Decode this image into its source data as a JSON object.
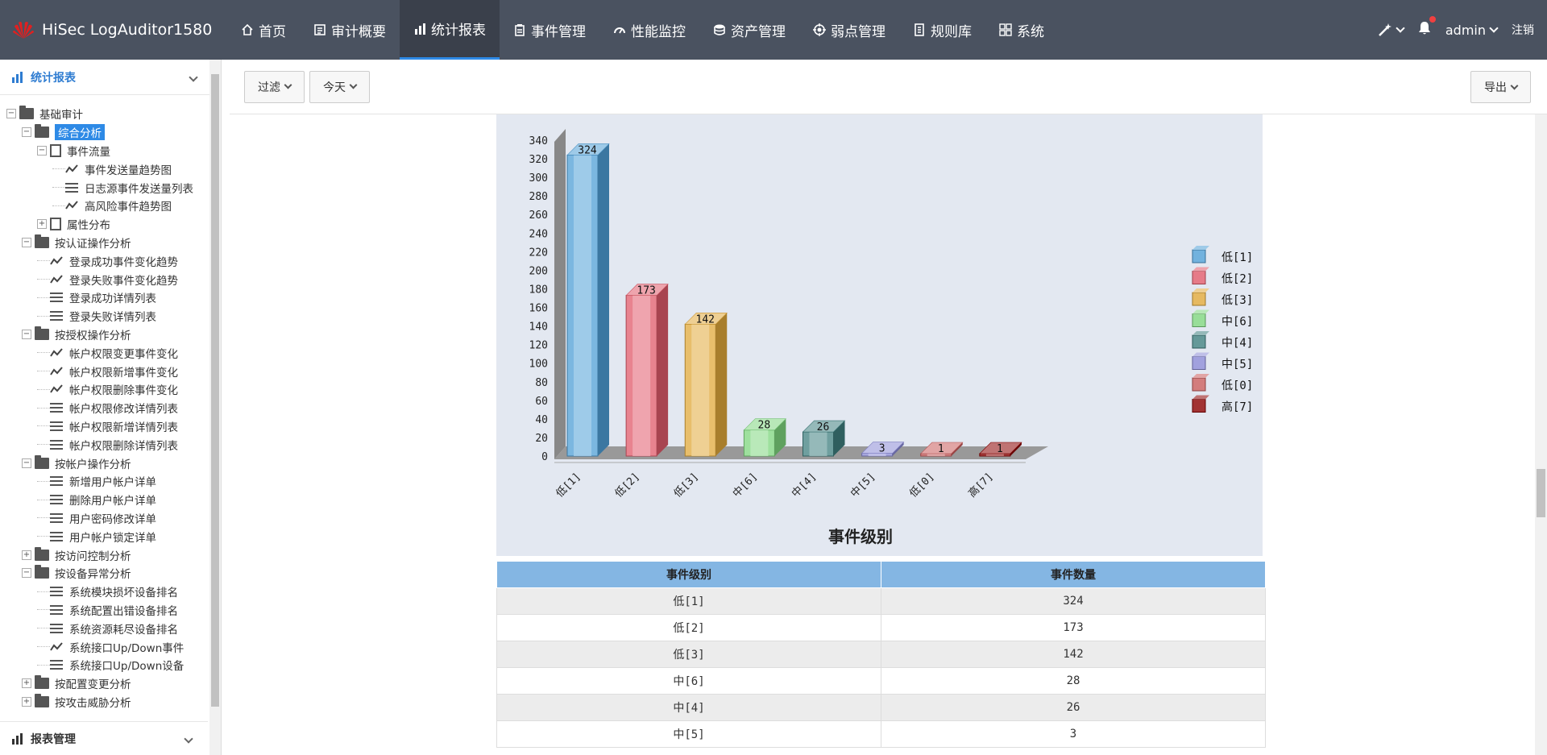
{
  "app": {
    "title": "HiSec LogAuditor1580"
  },
  "nav": [
    {
      "label": "首页",
      "icon": "home-icon"
    },
    {
      "label": "审计概要",
      "icon": "report-icon"
    },
    {
      "label": "统计报表",
      "icon": "bar-chart-icon",
      "active": true
    },
    {
      "label": "事件管理",
      "icon": "clipboard-icon"
    },
    {
      "label": "性能监控",
      "icon": "gauge-icon"
    },
    {
      "label": "资产管理",
      "icon": "database-icon"
    },
    {
      "label": "弱点管理",
      "icon": "target-icon"
    },
    {
      "label": "规则库",
      "icon": "book-icon"
    },
    {
      "label": "系统",
      "icon": "grid-icon"
    }
  ],
  "user": {
    "name": "admin",
    "logout": "注销"
  },
  "sidebar": {
    "header": "统计报表",
    "footer": "报表管理",
    "tree": [
      {
        "label": "基础审计",
        "level": 0,
        "kind": "folder-open",
        "toggle": "−"
      },
      {
        "label": "综合分析",
        "level": 1,
        "kind": "folder",
        "toggle": "−",
        "selected": true
      },
      {
        "label": "事件流量",
        "level": 2,
        "kind": "doc",
        "toggle": "−"
      },
      {
        "label": "事件发送量趋势图",
        "level": 3,
        "kind": "trend"
      },
      {
        "label": "日志源事件发送量列表",
        "level": 3,
        "kind": "list"
      },
      {
        "label": "高风险事件趋势图",
        "level": 3,
        "kind": "trend"
      },
      {
        "label": "属性分布",
        "level": 2,
        "kind": "doc",
        "toggle": "+"
      },
      {
        "label": "按认证操作分析",
        "level": 1,
        "kind": "folder",
        "toggle": "−"
      },
      {
        "label": "登录成功事件变化趋势",
        "level": 2,
        "kind": "trend"
      },
      {
        "label": "登录失败事件变化趋势",
        "level": 2,
        "kind": "trend"
      },
      {
        "label": "登录成功详情列表",
        "level": 2,
        "kind": "list"
      },
      {
        "label": "登录失败详情列表",
        "level": 2,
        "kind": "list"
      },
      {
        "label": "按授权操作分析",
        "level": 1,
        "kind": "folder",
        "toggle": "−"
      },
      {
        "label": "帐户权限变更事件变化",
        "level": 2,
        "kind": "trend"
      },
      {
        "label": "帐户权限新增事件变化",
        "level": 2,
        "kind": "trend"
      },
      {
        "label": "帐户权限删除事件变化",
        "level": 2,
        "kind": "trend"
      },
      {
        "label": "帐户权限修改详情列表",
        "level": 2,
        "kind": "list"
      },
      {
        "label": "帐户权限新增详情列表",
        "level": 2,
        "kind": "list"
      },
      {
        "label": "帐户权限删除详情列表",
        "level": 2,
        "kind": "list"
      },
      {
        "label": "按帐户操作分析",
        "level": 1,
        "kind": "folder",
        "toggle": "−"
      },
      {
        "label": "新增用户帐户详单",
        "level": 2,
        "kind": "list"
      },
      {
        "label": "删除用户帐户详单",
        "level": 2,
        "kind": "list"
      },
      {
        "label": "用户密码修改详单",
        "level": 2,
        "kind": "list"
      },
      {
        "label": "用户帐户锁定详单",
        "level": 2,
        "kind": "list"
      },
      {
        "label": "按访问控制分析",
        "level": 1,
        "kind": "folder",
        "toggle": "+"
      },
      {
        "label": "按设备异常分析",
        "level": 1,
        "kind": "folder",
        "toggle": "−"
      },
      {
        "label": "系统模块损坏设备排名",
        "level": 2,
        "kind": "list"
      },
      {
        "label": "系统配置出错设备排名",
        "level": 2,
        "kind": "list"
      },
      {
        "label": "系统资源耗尽设备排名",
        "level": 2,
        "kind": "list"
      },
      {
        "label": "系统接口Up/Down事件",
        "level": 2,
        "kind": "trend"
      },
      {
        "label": "系统接口Up/Down设备",
        "level": 2,
        "kind": "list"
      },
      {
        "label": "按配置变更分析",
        "level": 1,
        "kind": "folder",
        "toggle": "+"
      },
      {
        "label": "按攻击威胁分析",
        "level": 1,
        "kind": "folder",
        "toggle": "+"
      }
    ]
  },
  "toolbar": {
    "filter": "过滤",
    "time": "今天",
    "export": "导出"
  },
  "chart_data": {
    "type": "bar",
    "categories": [
      "低[1]",
      "低[2]",
      "低[3]",
      "中[6]",
      "中[4]",
      "中[5]",
      "低[0]",
      "高[7]"
    ],
    "values": [
      324,
      173,
      142,
      28,
      26,
      3,
      1,
      1
    ],
    "colors": [
      "#4f9fd6",
      "#e05a6a",
      "#e0a83a",
      "#7ed67e",
      "#3f7f7f",
      "#8a8ad6",
      "#c85c5c",
      "#8b0000"
    ],
    "xlabel": "事件级别",
    "ylabel": "",
    "ylim": [
      0,
      340
    ],
    "yticks": [
      0,
      20,
      40,
      60,
      80,
      100,
      120,
      140,
      160,
      180,
      200,
      220,
      240,
      260,
      280,
      300,
      320,
      340
    ],
    "legend": [
      "低[1]",
      "低[2]",
      "低[3]",
      "中[6]",
      "中[4]",
      "中[5]",
      "低[0]",
      "高[7]"
    ],
    "legend_position": "right"
  },
  "table": {
    "headers": [
      "事件级别",
      "事件数量"
    ],
    "rows": [
      [
        "低[1]",
        "324"
      ],
      [
        "低[2]",
        "173"
      ],
      [
        "低[3]",
        "142"
      ],
      [
        "中[6]",
        "28"
      ],
      [
        "中[4]",
        "26"
      ],
      [
        "中[5]",
        "3"
      ]
    ]
  }
}
